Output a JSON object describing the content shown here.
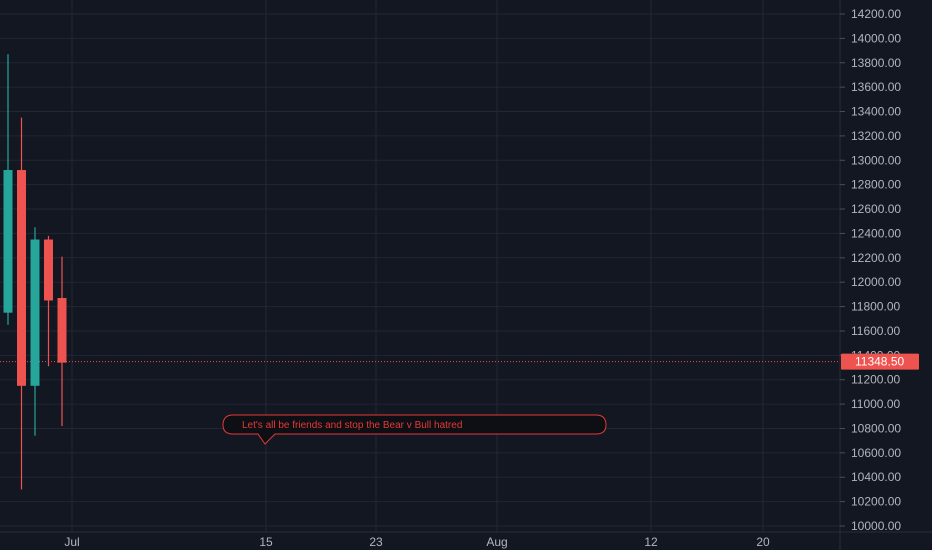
{
  "colors": {
    "background": "#131722",
    "grid": "#232733",
    "axis_text": "#b2b5be",
    "up": "#26a69a",
    "down": "#ef5350",
    "price_line": "#ef5350",
    "note_border": "#e53935",
    "note_fill": "#0d0f14"
  },
  "chart_data": {
    "type": "candlestick",
    "title": "",
    "y_axis": {
      "min": 10000,
      "max": 14200,
      "ticks": [
        "10000.00",
        "10200.00",
        "10400.00",
        "10600.00",
        "10800.00",
        "11000.00",
        "11200.00",
        "11400.00",
        "11600.00",
        "11800.00",
        "12000.00",
        "12200.00",
        "12400.00",
        "12600.00",
        "12800.00",
        "13000.00",
        "13200.00",
        "13400.00",
        "13600.00",
        "13800.00",
        "14000.00",
        "14200.00"
      ]
    },
    "x_axis": {
      "labels": [
        "Jul",
        "15",
        "23",
        "Aug",
        "12",
        "20"
      ]
    },
    "candles": [
      {
        "open": 11750,
        "high": 13870,
        "low": 11650,
        "close": 12920
      },
      {
        "open": 12920,
        "high": 13350,
        "low": 10300,
        "close": 11150
      },
      {
        "open": 11150,
        "high": 12450,
        "low": 10740,
        "close": 12350
      },
      {
        "open": 12350,
        "high": 12380,
        "low": 11310,
        "close": 11850
      },
      {
        "open": 11870,
        "high": 12210,
        "low": 10820,
        "close": 11340
      }
    ],
    "last_price": {
      "value": 11348.5,
      "label": "11348.50"
    },
    "annotation": {
      "text": "Let's all be friends and stop the Bear v Bull hatred"
    }
  }
}
